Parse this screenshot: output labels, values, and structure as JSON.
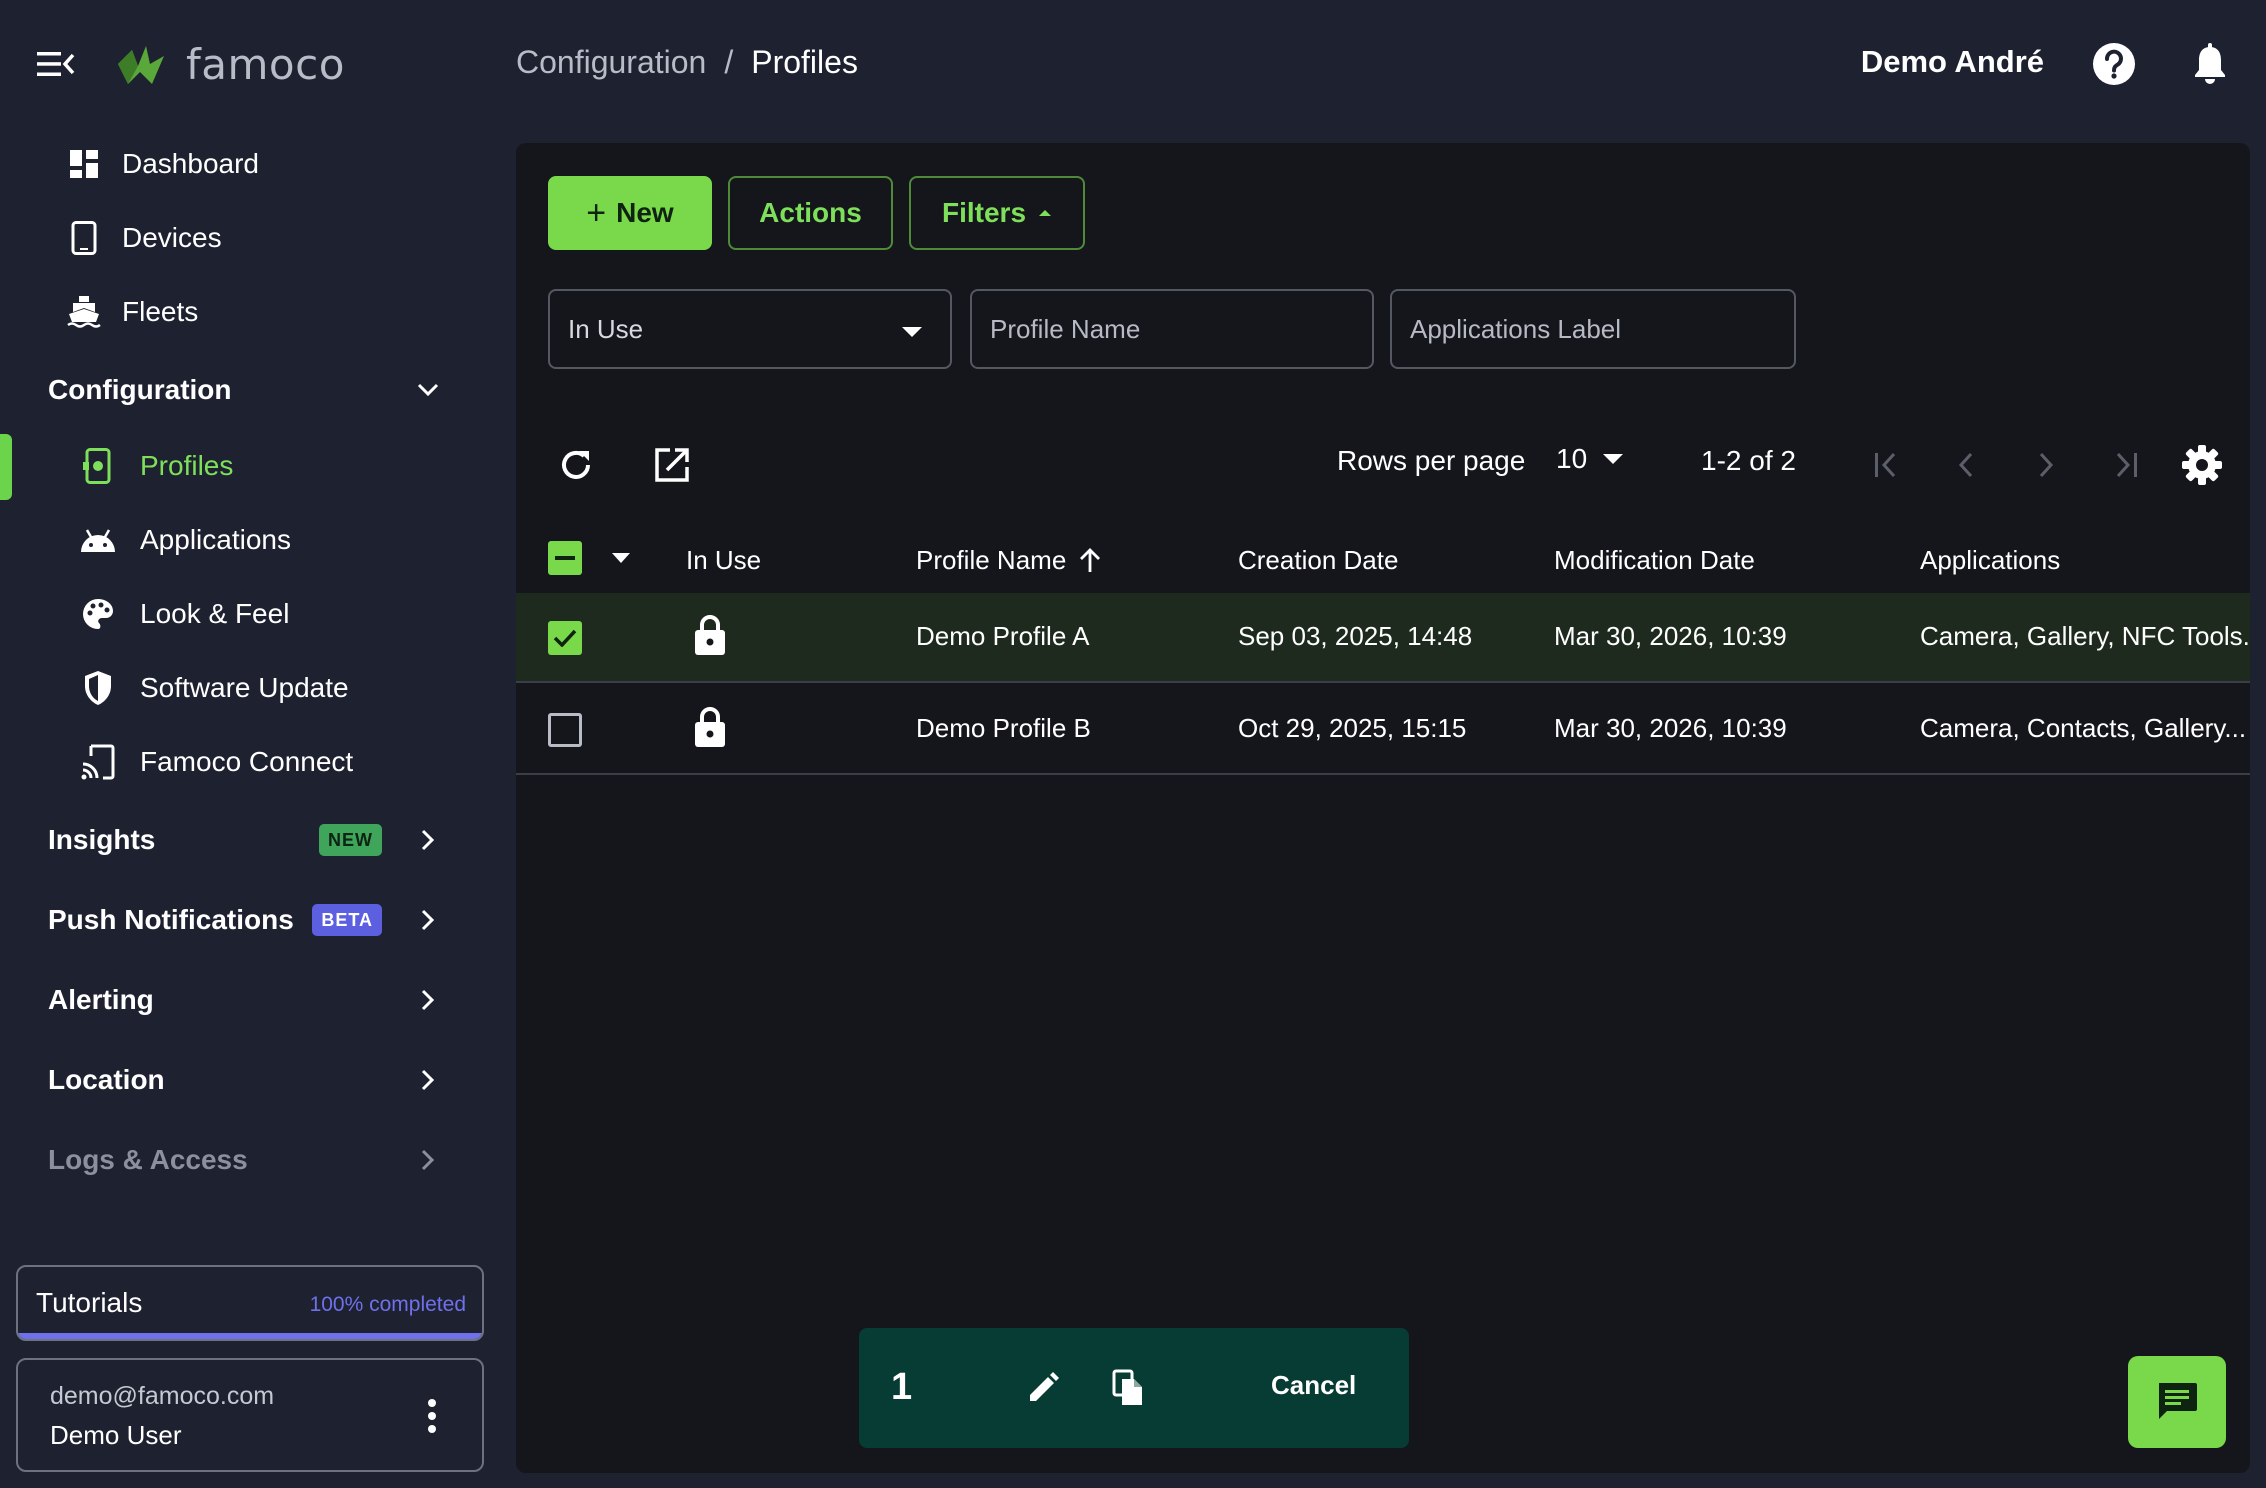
{
  "brand": {
    "name": "famoco",
    "logo_icon": "famoco-logo-icon",
    "accent": "#79d94a"
  },
  "sidebar": {
    "top_items": [
      {
        "label": "Dashboard",
        "icon": "dashboard-icon"
      },
      {
        "label": "Devices",
        "icon": "device-icon"
      },
      {
        "label": "Fleets",
        "icon": "ship-icon"
      }
    ],
    "configuration": {
      "label": "Configuration",
      "expanded": true,
      "items": [
        {
          "label": "Profiles",
          "icon": "profile-settings-icon",
          "active": true
        },
        {
          "label": "Applications",
          "icon": "android-icon"
        },
        {
          "label": "Look & Feel",
          "icon": "palette-icon"
        },
        {
          "label": "Software Update",
          "icon": "shield-icon"
        },
        {
          "label": "Famoco Connect",
          "icon": "cast-icon"
        }
      ]
    },
    "sections": [
      {
        "label": "Insights",
        "badge": "NEW"
      },
      {
        "label": "Push Notifications",
        "badge": "BETA"
      },
      {
        "label": "Alerting"
      },
      {
        "label": "Location"
      },
      {
        "label": "Logs & Access"
      }
    ],
    "tutorials": {
      "label": "Tutorials",
      "progress_text": "100% completed",
      "progress": 1.0
    },
    "user": {
      "email": "demo@famoco.com",
      "name": "Demo User"
    }
  },
  "header": {
    "breadcrumb": {
      "parent": "Configuration",
      "separator": "/",
      "current": "Profiles"
    },
    "user_name": "Demo André"
  },
  "toolbar": {
    "new_label": "New",
    "actions_label": "Actions",
    "filters_label": "Filters"
  },
  "filters": {
    "in_use": {
      "value": "In Use"
    },
    "profile_name": {
      "placeholder": "Profile Name"
    },
    "applications_label": {
      "placeholder": "Applications Label"
    }
  },
  "pagination": {
    "rows_per_page_label": "Rows per page",
    "rows_per_page": "10",
    "range": "1-2 of 2"
  },
  "table": {
    "columns": [
      "In Use",
      "Profile Name",
      "Creation Date",
      "Modification Date",
      "Applications"
    ],
    "sorted_column": "Profile Name",
    "sort_direction": "ascending",
    "rows": [
      {
        "selected": true,
        "in_use_icon": "lock-icon",
        "profile_name": "Demo Profile A",
        "creation_date": "Sep 03, 2025, 14:48",
        "modification_date": "Mar 30, 2026, 10:39",
        "applications": "Camera, Gallery, NFC Tools..."
      },
      {
        "selected": false,
        "in_use_icon": "lock-icon",
        "profile_name": "Demo Profile B",
        "creation_date": "Oct 29, 2025, 15:15",
        "modification_date": "Mar 30, 2026, 10:39",
        "applications": "Camera, Contacts, Gallery..."
      }
    ]
  },
  "selection_bar": {
    "count": "1",
    "cancel_label": "Cancel"
  }
}
